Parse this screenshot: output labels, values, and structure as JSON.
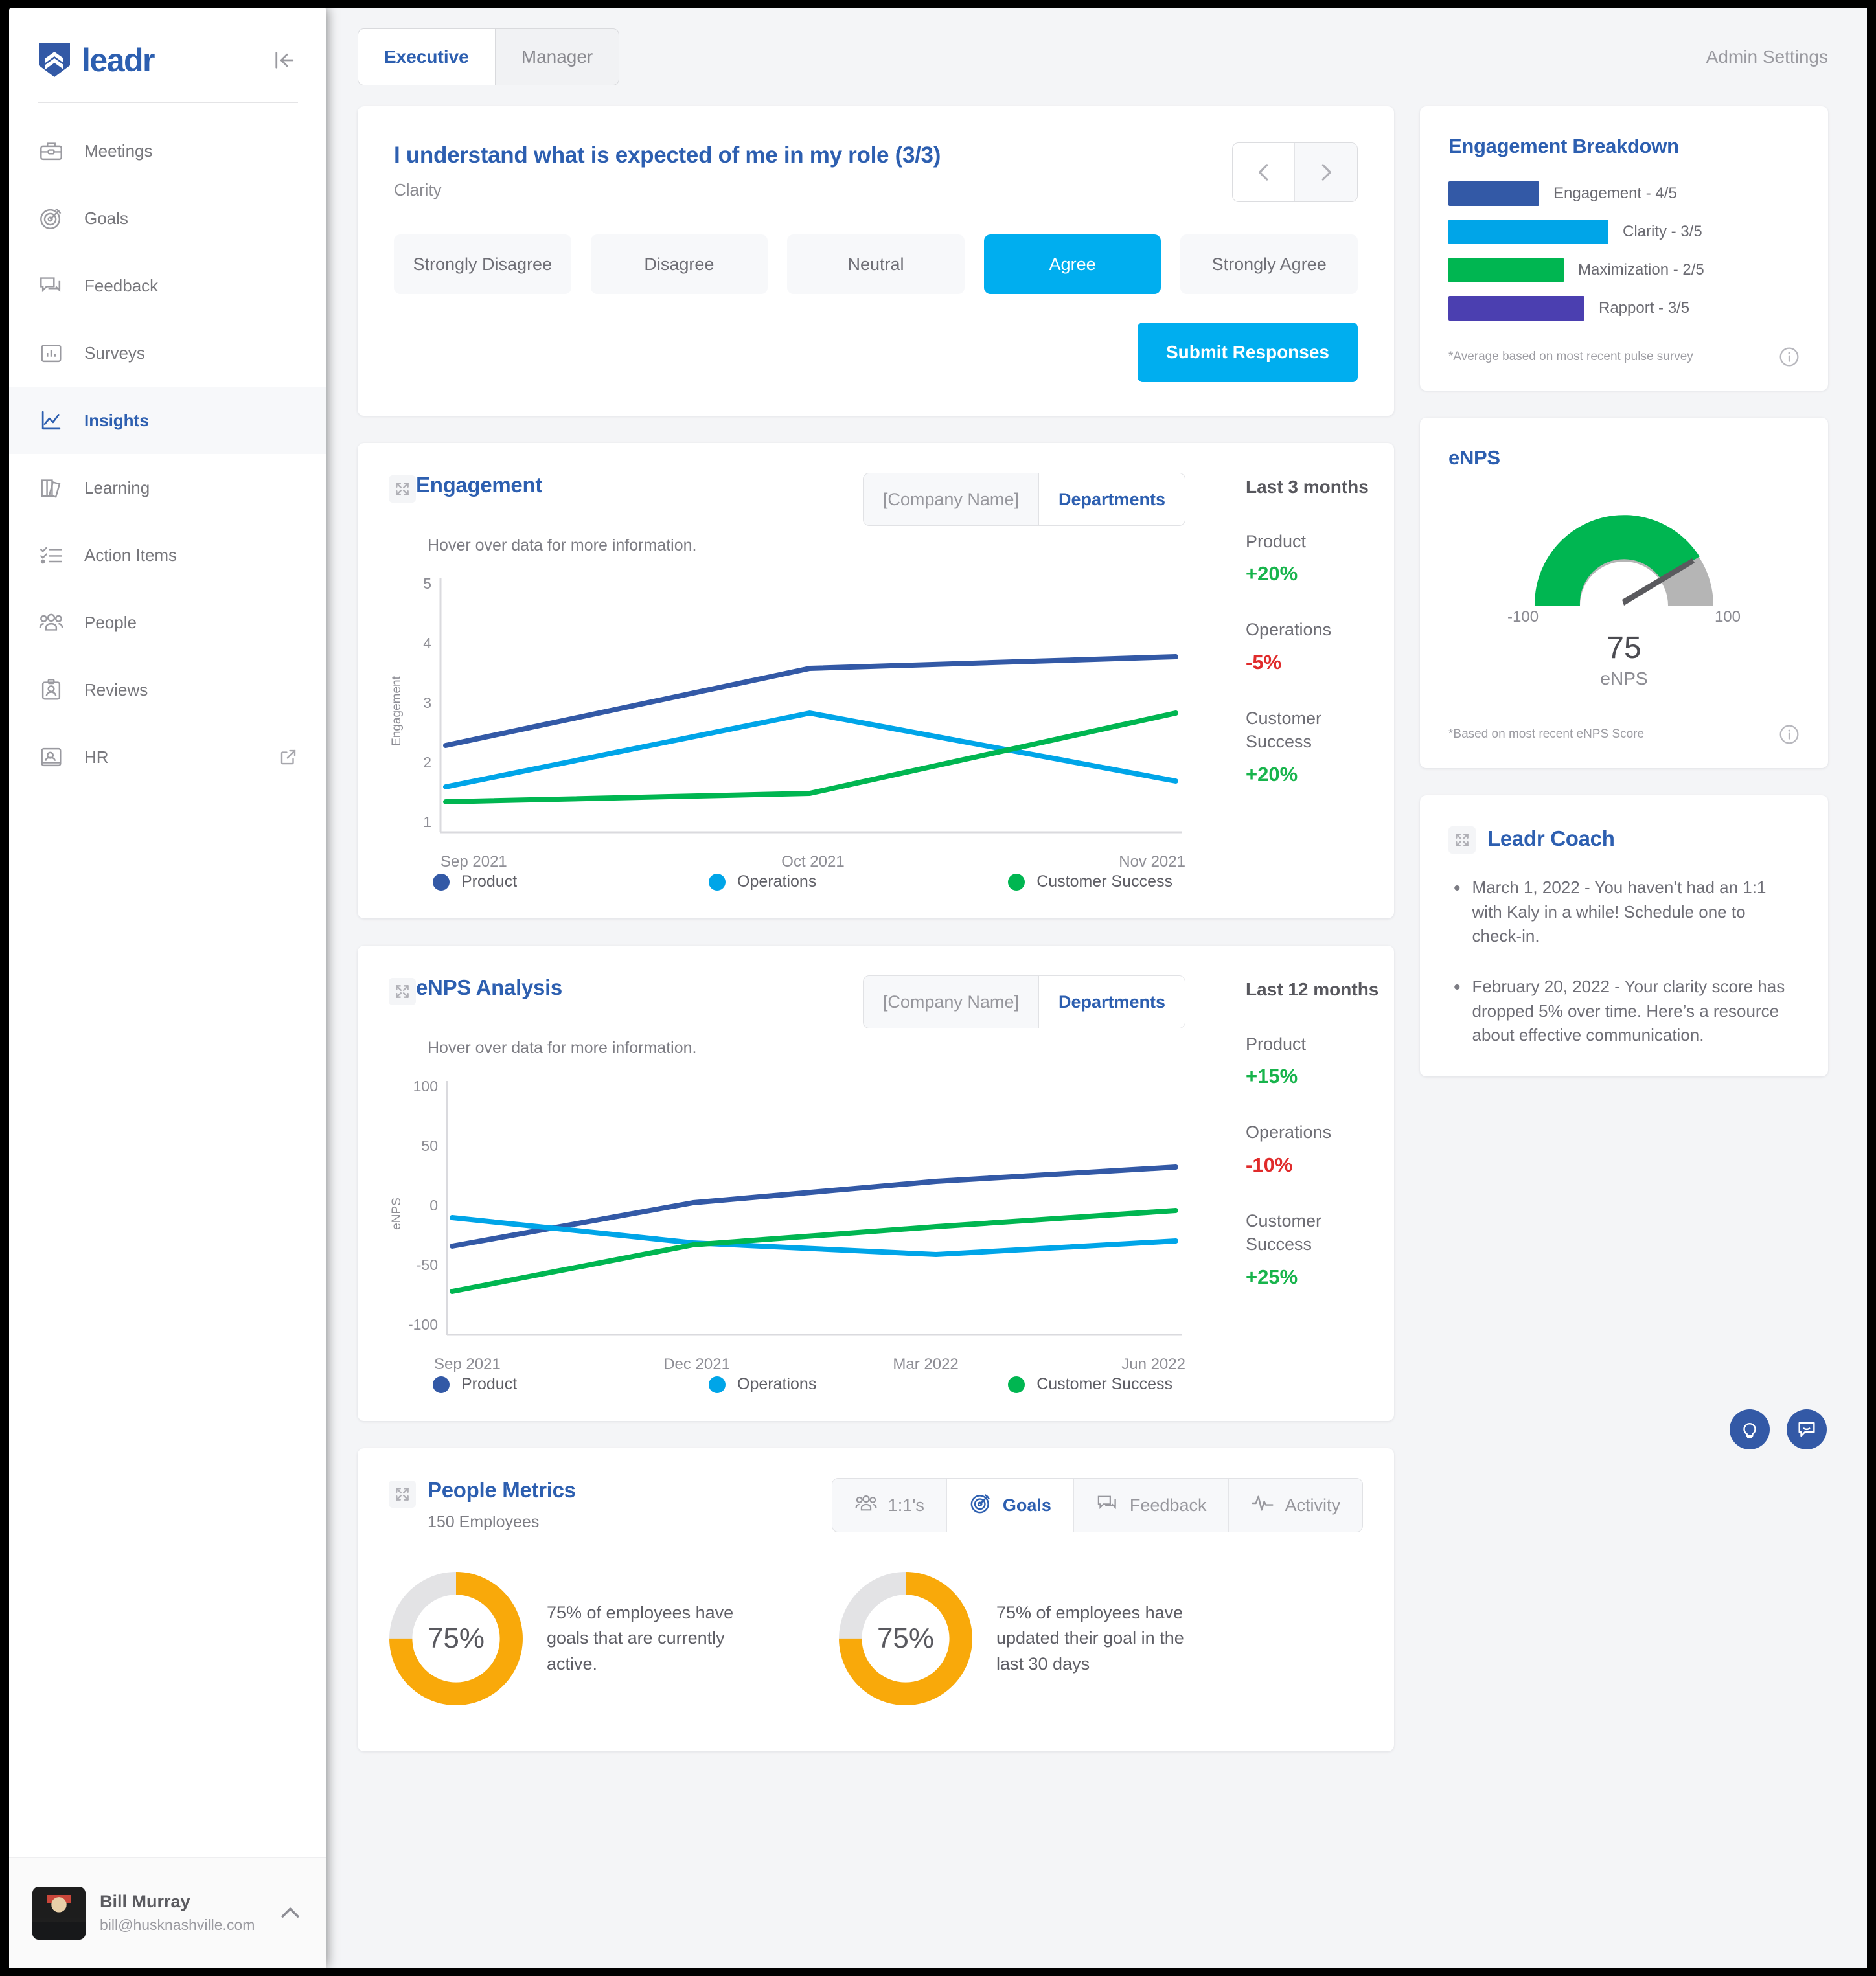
{
  "sidebar": {
    "brand": "leadr",
    "items": [
      {
        "label": "Meetings",
        "icon": "briefcase-icon"
      },
      {
        "label": "Goals",
        "icon": "target-icon"
      },
      {
        "label": "Feedback",
        "icon": "chat-icon"
      },
      {
        "label": "Surveys",
        "icon": "bar-chart-icon"
      },
      {
        "label": "Insights",
        "icon": "line-chart-icon"
      },
      {
        "label": "Learning",
        "icon": "books-icon"
      },
      {
        "label": "Action Items",
        "icon": "checklist-icon"
      },
      {
        "label": "People",
        "icon": "people-icon"
      },
      {
        "label": "Reviews",
        "icon": "clipboard-user-icon"
      },
      {
        "label": "HR",
        "icon": "id-card-icon"
      }
    ],
    "active_index": 4,
    "user": {
      "name": "Bill Murray",
      "email": "bill@husknashville.com"
    }
  },
  "topbar": {
    "tabs": [
      {
        "label": "Executive"
      },
      {
        "label": "Manager"
      }
    ],
    "active_tab": 0,
    "admin_settings": "Admin Settings"
  },
  "survey": {
    "question": "I understand what is expected of me in my role (3/3)",
    "category": "Clarity",
    "options": [
      "Strongly Disagree",
      "Disagree",
      "Neutral",
      "Agree",
      "Strongly Agree"
    ],
    "selected_index": 3,
    "submit_label": "Submit Responses"
  },
  "engagement_breakdown": {
    "title": "Engagement Breakdown",
    "items": [
      {
        "label": "Engagement - 4/5",
        "value": 4,
        "max": 5,
        "color": "#3359a6",
        "width_pct": 44
      },
      {
        "label": "Clarity - 3/5",
        "value": 3,
        "max": 5,
        "color": "#00a5e8",
        "width_pct": 78
      },
      {
        "label": "Maximization - 2/5",
        "value": 2,
        "max": 5,
        "color": "#00b651",
        "width_pct": 56
      },
      {
        "label": "Rapport - 3/5",
        "value": 3,
        "max": 5,
        "color": "#4b3fb0",
        "width_pct": 66
      }
    ],
    "note": "*Average based on most recent pulse survey"
  },
  "enps_gauge": {
    "title": "eNPS",
    "min_label": "-100",
    "max_label": "100",
    "value": "75",
    "unit": "eNPS",
    "note": "*Based on most recent eNPS Score",
    "fill_color": "#00b651",
    "track_color": "#b5b5b5"
  },
  "coach": {
    "title": "Leadr Coach",
    "items": [
      "March 1, 2022 - You haven’t had an 1:1 with Kaly in a while! Schedule one to check-in.",
      "February 20, 2022 - Your clarity score has dropped 5% over time. Here’s a resource about effective communication."
    ]
  },
  "engagement_card": {
    "title": "Engagement",
    "subtitle": "Hover over data for more information.",
    "scope_tabs": [
      "[Company Name]",
      "Departments"
    ],
    "scope_active": 1,
    "stats_title": "Last 3 months",
    "stats": [
      {
        "dept": "Product",
        "value": "+20%",
        "color": "#18b44c"
      },
      {
        "dept": "Operations",
        "value": "-5%",
        "color": "#e02b2b"
      },
      {
        "dept": "Customer Success",
        "value": "+20%",
        "color": "#18b44c"
      }
    ]
  },
  "enps_card": {
    "title": "eNPS Analysis",
    "subtitle": "Hover over data for more information.",
    "scope_tabs": [
      "[Company Name]",
      "Departments"
    ],
    "scope_active": 1,
    "stats_title": "Last 12 months",
    "stats": [
      {
        "dept": "Product",
        "value": "+15%",
        "color": "#18b44c"
      },
      {
        "dept": "Operations",
        "value": "-10%",
        "color": "#e02b2b"
      },
      {
        "dept": "Customer Success",
        "value": "+25%",
        "color": "#18b44c"
      }
    ]
  },
  "people_metrics": {
    "title": "People Metrics",
    "subtitle": "150 Employees",
    "tabs": [
      {
        "label": "1:1's",
        "icon": "people-icon"
      },
      {
        "label": "Goals",
        "icon": "target-icon"
      },
      {
        "label": "Feedback",
        "icon": "chat-icon"
      },
      {
        "label": "Activity",
        "icon": "activity-icon"
      }
    ],
    "active_tab": 1,
    "donuts": [
      {
        "percent": "75%",
        "value": 75,
        "text": "75% of employees have goals that are currently active."
      },
      {
        "percent": "75%",
        "value": 75,
        "text": "75% of employees have updated their goal in the last 30 days"
      }
    ],
    "donut_color": "#f9a90a",
    "donut_track": "#e3e3e5"
  },
  "fabs": [
    {
      "icon": "lightbulb-icon"
    },
    {
      "icon": "speech-bubble-icon"
    }
  ],
  "chart_data": [
    {
      "type": "line",
      "title": "Engagement",
      "xlabel": "",
      "ylabel": "Engagement",
      "x": [
        "Sep 2021",
        "Oct 2021",
        "Nov 2021"
      ],
      "ylim": [
        1,
        5
      ],
      "yticks": [
        1,
        2,
        3,
        4,
        5
      ],
      "grid": false,
      "legend_position": "bottom",
      "series": [
        {
          "name": "Product",
          "color": "#3359a6",
          "values": [
            2.3,
            3.6,
            3.8
          ]
        },
        {
          "name": "Operations",
          "color": "#00a5e8",
          "values": [
            1.6,
            2.85,
            1.7
          ]
        },
        {
          "name": "Customer Success",
          "color": "#00b651",
          "values": [
            1.35,
            1.5,
            2.85
          ]
        }
      ]
    },
    {
      "type": "line",
      "title": "eNPS Analysis",
      "xlabel": "",
      "ylabel": "eNPS",
      "x": [
        "Sep 2021",
        "Dec 2021",
        "Mar 2022",
        "Jun 2022"
      ],
      "ylim": [
        -100,
        100
      ],
      "yticks": [
        -100,
        -50,
        0,
        50,
        100
      ],
      "grid": false,
      "legend_position": "bottom",
      "series": [
        {
          "name": "Product",
          "color": "#3359a6",
          "values": [
            -34,
            2,
            20,
            32
          ]
        },
        {
          "name": "Operations",
          "color": "#00a5e8",
          "values": [
            -10,
            -31,
            -41,
            -30
          ]
        },
        {
          "name": "Customer Success",
          "color": "#00b651",
          "values": [
            -72,
            -33,
            -18,
            -4
          ]
        }
      ]
    }
  ]
}
